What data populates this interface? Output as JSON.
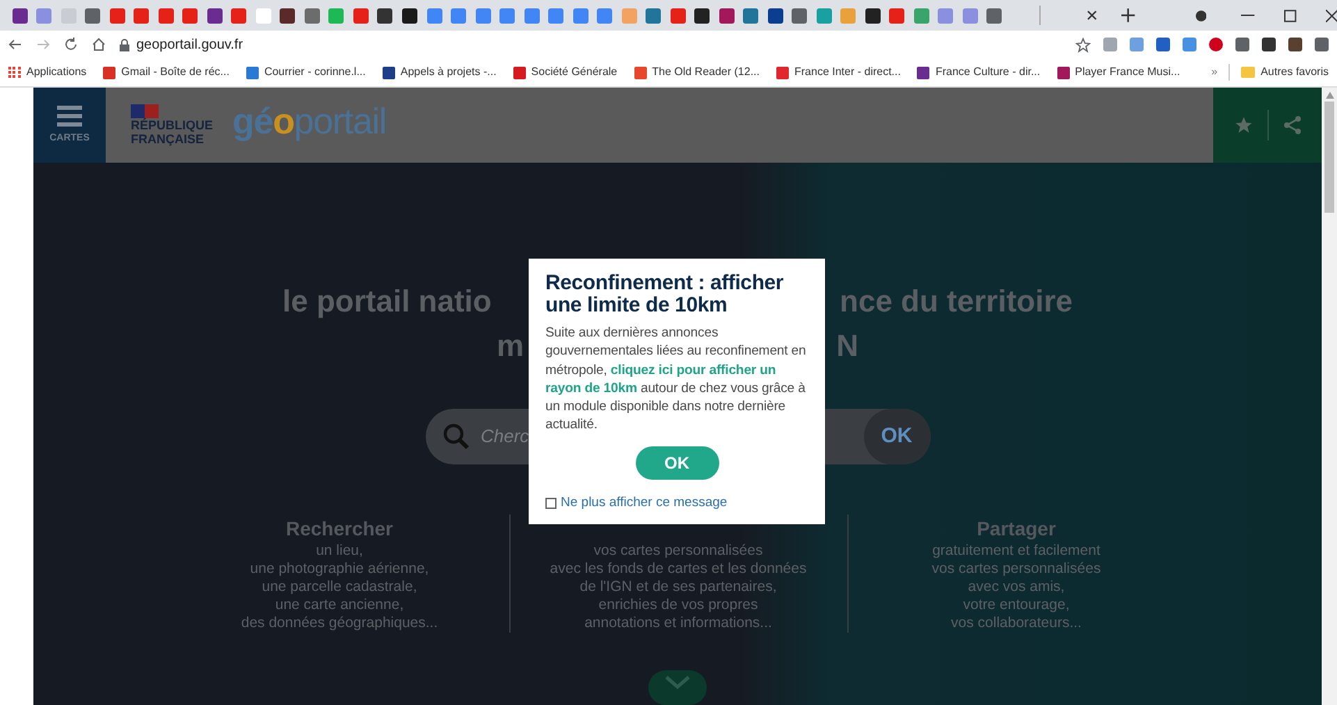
{
  "browser": {
    "url": "geoportail.gouv.fr",
    "bookmarks": [
      {
        "label": "Applications",
        "color": "#e8453c"
      },
      {
        "label": "Gmail - Boîte de réc...",
        "color": "#d93025"
      },
      {
        "label": "Courrier - corinne.l...",
        "color": "#2a7ad5"
      },
      {
        "label": "Appels à projets -...",
        "color": "#1f3e8a"
      },
      {
        "label": "Société Générale",
        "color": "#d71920"
      },
      {
        "label": "The Old Reader (12...",
        "color": "#e9472b"
      },
      {
        "label": "France Inter - direct...",
        "color": "#e2262e"
      },
      {
        "label": "France Culture - dir...",
        "color": "#6b2c91"
      },
      {
        "label": "Player France Musi...",
        "color": "#a2185b"
      }
    ],
    "more_bookmarks": "»",
    "other_bookmarks": "Autres favoris"
  },
  "header": {
    "menu_label": "CARTES",
    "republic_lines": [
      "RÉPUBLIQUE",
      "FRANÇAISE"
    ],
    "logo": [
      {
        "text": "gé",
        "color": "#4a7196"
      },
      {
        "text": "o",
        "color": "#c8901e"
      },
      {
        "text": "portail",
        "color": "#4a7196"
      }
    ]
  },
  "hero": {
    "line_1": [
      "le portail natio",
      "nce du territoire"
    ],
    "line_2": [
      "m",
      "N"
    ],
    "search": {
      "placeholder": "Cherc",
      "button": "OK"
    },
    "columns": [
      {
        "title": "Rechercher",
        "lines": [
          "un lieu,",
          "une photographie aérienne,",
          "une parcelle cadastrale,",
          "une carte ancienne,",
          "des données géographiques..."
        ]
      },
      {
        "lines": [
          "vos cartes personnalisées",
          "avec les fonds de cartes et les données",
          "de l'IGN et de ses partenaires,",
          "enrichies de vos propres",
          "annotations et informations..."
        ]
      },
      {
        "title": "Partager",
        "lines": [
          "gratuitement et facilement",
          "vos cartes personnalisées",
          "avec vos amis,",
          "votre entourage,",
          "vos collaborateurs..."
        ]
      }
    ]
  },
  "dialog": {
    "title": "Reconfinement : afficher une limite de 10km",
    "body": "Suite aux dernières annonces gouvernementales liées au reconfinement en métropole, **cliquez ici pour afficher un rayon de 10km** autour de chez vous grâce à un module disponible dans notre dernière actualité.",
    "button": "OK",
    "checkbox": {
      "label": "Ne plus afficher ce message",
      "checked": false
    }
  }
}
